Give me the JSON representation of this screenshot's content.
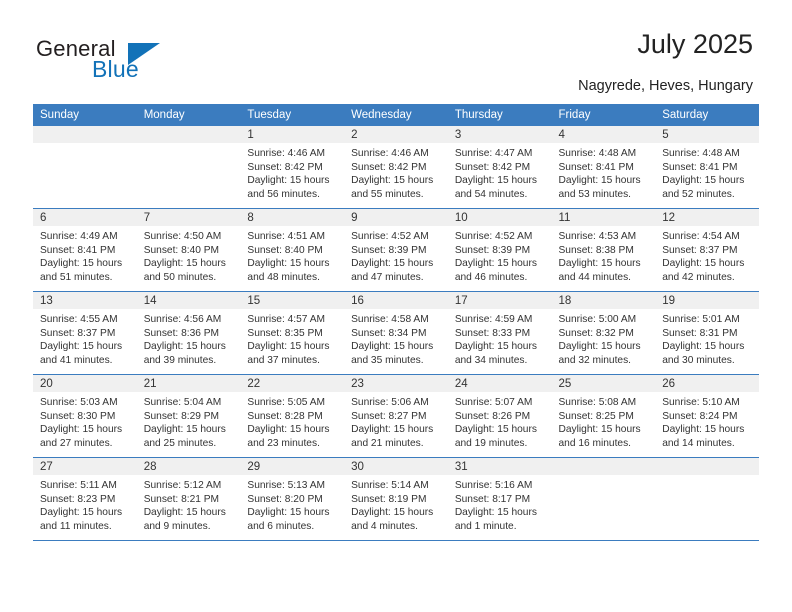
{
  "brand": {
    "name_dark": "General",
    "name_blue": "Blue",
    "accent_color": "#1272b8",
    "triangle_icon": "brand-triangle-icon"
  },
  "header": {
    "title": "July 2025",
    "subtitle": "Nagyrede, Heves, Hungary"
  },
  "theme": {
    "header_blue": "#3b7cbf",
    "daynum_band": "#f0f0f0",
    "text": "#333333"
  },
  "calendar": {
    "weekday_headers": [
      "Sunday",
      "Monday",
      "Tuesday",
      "Wednesday",
      "Thursday",
      "Friday",
      "Saturday"
    ],
    "weeks": [
      [
        {
          "day": "",
          "lines": []
        },
        {
          "day": "",
          "lines": []
        },
        {
          "day": "1",
          "lines": [
            "Sunrise: 4:46 AM",
            "Sunset: 8:42 PM",
            "Daylight: 15 hours",
            "and 56 minutes."
          ]
        },
        {
          "day": "2",
          "lines": [
            "Sunrise: 4:46 AM",
            "Sunset: 8:42 PM",
            "Daylight: 15 hours",
            "and 55 minutes."
          ]
        },
        {
          "day": "3",
          "lines": [
            "Sunrise: 4:47 AM",
            "Sunset: 8:42 PM",
            "Daylight: 15 hours",
            "and 54 minutes."
          ]
        },
        {
          "day": "4",
          "lines": [
            "Sunrise: 4:48 AM",
            "Sunset: 8:41 PM",
            "Daylight: 15 hours",
            "and 53 minutes."
          ]
        },
        {
          "day": "5",
          "lines": [
            "Sunrise: 4:48 AM",
            "Sunset: 8:41 PM",
            "Daylight: 15 hours",
            "and 52 minutes."
          ]
        }
      ],
      [
        {
          "day": "6",
          "lines": [
            "Sunrise: 4:49 AM",
            "Sunset: 8:41 PM",
            "Daylight: 15 hours",
            "and 51 minutes."
          ]
        },
        {
          "day": "7",
          "lines": [
            "Sunrise: 4:50 AM",
            "Sunset: 8:40 PM",
            "Daylight: 15 hours",
            "and 50 minutes."
          ]
        },
        {
          "day": "8",
          "lines": [
            "Sunrise: 4:51 AM",
            "Sunset: 8:40 PM",
            "Daylight: 15 hours",
            "and 48 minutes."
          ]
        },
        {
          "day": "9",
          "lines": [
            "Sunrise: 4:52 AM",
            "Sunset: 8:39 PM",
            "Daylight: 15 hours",
            "and 47 minutes."
          ]
        },
        {
          "day": "10",
          "lines": [
            "Sunrise: 4:52 AM",
            "Sunset: 8:39 PM",
            "Daylight: 15 hours",
            "and 46 minutes."
          ]
        },
        {
          "day": "11",
          "lines": [
            "Sunrise: 4:53 AM",
            "Sunset: 8:38 PM",
            "Daylight: 15 hours",
            "and 44 minutes."
          ]
        },
        {
          "day": "12",
          "lines": [
            "Sunrise: 4:54 AM",
            "Sunset: 8:37 PM",
            "Daylight: 15 hours",
            "and 42 minutes."
          ]
        }
      ],
      [
        {
          "day": "13",
          "lines": [
            "Sunrise: 4:55 AM",
            "Sunset: 8:37 PM",
            "Daylight: 15 hours",
            "and 41 minutes."
          ]
        },
        {
          "day": "14",
          "lines": [
            "Sunrise: 4:56 AM",
            "Sunset: 8:36 PM",
            "Daylight: 15 hours",
            "and 39 minutes."
          ]
        },
        {
          "day": "15",
          "lines": [
            "Sunrise: 4:57 AM",
            "Sunset: 8:35 PM",
            "Daylight: 15 hours",
            "and 37 minutes."
          ]
        },
        {
          "day": "16",
          "lines": [
            "Sunrise: 4:58 AM",
            "Sunset: 8:34 PM",
            "Daylight: 15 hours",
            "and 35 minutes."
          ]
        },
        {
          "day": "17",
          "lines": [
            "Sunrise: 4:59 AM",
            "Sunset: 8:33 PM",
            "Daylight: 15 hours",
            "and 34 minutes."
          ]
        },
        {
          "day": "18",
          "lines": [
            "Sunrise: 5:00 AM",
            "Sunset: 8:32 PM",
            "Daylight: 15 hours",
            "and 32 minutes."
          ]
        },
        {
          "day": "19",
          "lines": [
            "Sunrise: 5:01 AM",
            "Sunset: 8:31 PM",
            "Daylight: 15 hours",
            "and 30 minutes."
          ]
        }
      ],
      [
        {
          "day": "20",
          "lines": [
            "Sunrise: 5:03 AM",
            "Sunset: 8:30 PM",
            "Daylight: 15 hours",
            "and 27 minutes."
          ]
        },
        {
          "day": "21",
          "lines": [
            "Sunrise: 5:04 AM",
            "Sunset: 8:29 PM",
            "Daylight: 15 hours",
            "and 25 minutes."
          ]
        },
        {
          "day": "22",
          "lines": [
            "Sunrise: 5:05 AM",
            "Sunset: 8:28 PM",
            "Daylight: 15 hours",
            "and 23 minutes."
          ]
        },
        {
          "day": "23",
          "lines": [
            "Sunrise: 5:06 AM",
            "Sunset: 8:27 PM",
            "Daylight: 15 hours",
            "and 21 minutes."
          ]
        },
        {
          "day": "24",
          "lines": [
            "Sunrise: 5:07 AM",
            "Sunset: 8:26 PM",
            "Daylight: 15 hours",
            "and 19 minutes."
          ]
        },
        {
          "day": "25",
          "lines": [
            "Sunrise: 5:08 AM",
            "Sunset: 8:25 PM",
            "Daylight: 15 hours",
            "and 16 minutes."
          ]
        },
        {
          "day": "26",
          "lines": [
            "Sunrise: 5:10 AM",
            "Sunset: 8:24 PM",
            "Daylight: 15 hours",
            "and 14 minutes."
          ]
        }
      ],
      [
        {
          "day": "27",
          "lines": [
            "Sunrise: 5:11 AM",
            "Sunset: 8:23 PM",
            "Daylight: 15 hours",
            "and 11 minutes."
          ]
        },
        {
          "day": "28",
          "lines": [
            "Sunrise: 5:12 AM",
            "Sunset: 8:21 PM",
            "Daylight: 15 hours",
            "and 9 minutes."
          ]
        },
        {
          "day": "29",
          "lines": [
            "Sunrise: 5:13 AM",
            "Sunset: 8:20 PM",
            "Daylight: 15 hours",
            "and 6 minutes."
          ]
        },
        {
          "day": "30",
          "lines": [
            "Sunrise: 5:14 AM",
            "Sunset: 8:19 PM",
            "Daylight: 15 hours",
            "and 4 minutes."
          ]
        },
        {
          "day": "31",
          "lines": [
            "Sunrise: 5:16 AM",
            "Sunset: 8:17 PM",
            "Daylight: 15 hours",
            "and 1 minute."
          ]
        },
        {
          "day": "",
          "lines": []
        },
        {
          "day": "",
          "lines": []
        }
      ]
    ]
  }
}
